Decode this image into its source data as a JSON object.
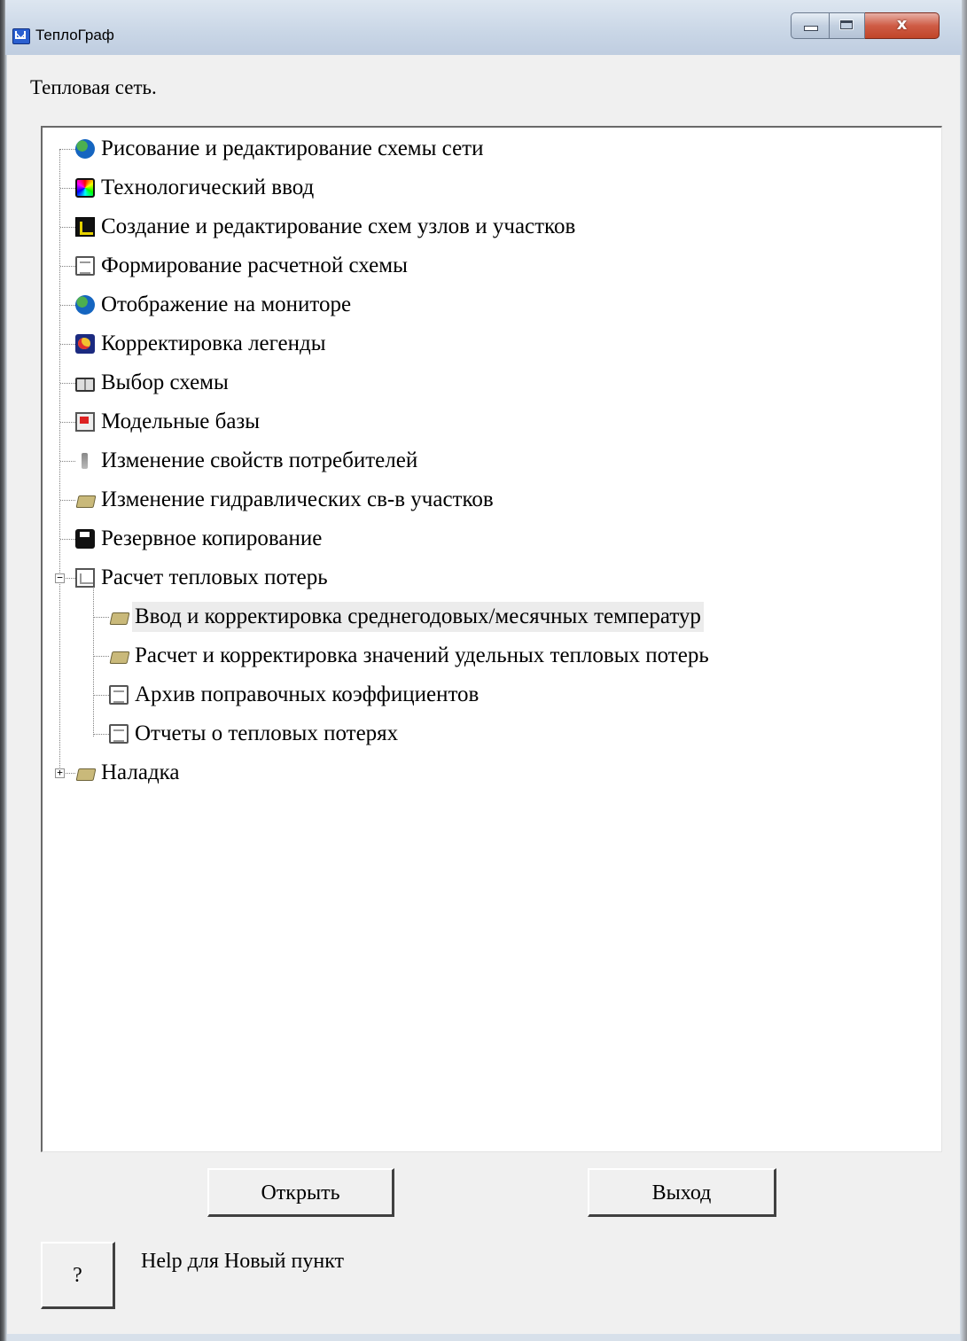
{
  "window": {
    "title": "ТеплоГраф",
    "close_glyph": "x"
  },
  "heading": "Тепловая сеть.",
  "tree": {
    "items": [
      {
        "label": "Рисование и редактирование схемы сети",
        "icon": "globe-icon"
      },
      {
        "label": "Технологический ввод",
        "icon": "colorwheel-icon"
      },
      {
        "label": "Создание и редактирование схем узлов и участков",
        "icon": "schema-icon"
      },
      {
        "label": "Формирование расчетной схемы",
        "icon": "document-icon"
      },
      {
        "label": "Отображение на мониторе",
        "icon": "globe-icon"
      },
      {
        "label": "Корректировка легенды",
        "icon": "palette-icon"
      },
      {
        "label": "Выбор схемы",
        "icon": "book-icon"
      },
      {
        "label": "Модельные базы",
        "icon": "database-icon"
      },
      {
        "label": "Изменение свойств потребителей",
        "icon": "tap-icon"
      },
      {
        "label": "Изменение гидравлических св-в участков",
        "icon": "folder-icon"
      },
      {
        "label": "Резервное копирование",
        "icon": "disk-icon"
      },
      {
        "label": "Расчет тепловых потерь",
        "icon": "chart-icon",
        "expanded": true,
        "expander": "−"
      },
      {
        "label": "Ввод и корректировка  среднегодовых/месячных температур",
        "icon": "folder-icon",
        "selected": true
      },
      {
        "label": "Расчет и корректировка значений удельных тепловых потерь",
        "icon": "folder-icon"
      },
      {
        "label": "Архив поправочных коэффициентов",
        "icon": "document-icon"
      },
      {
        "label": "Отчеты о тепловых потерях",
        "icon": "document-icon"
      },
      {
        "label": "Наладка",
        "icon": "folder-icon",
        "expanded": false,
        "expander": "+"
      }
    ]
  },
  "buttons": {
    "open": "Открыть",
    "exit": "Выход",
    "help": "?"
  },
  "help_text": "Help для Новый пункт"
}
